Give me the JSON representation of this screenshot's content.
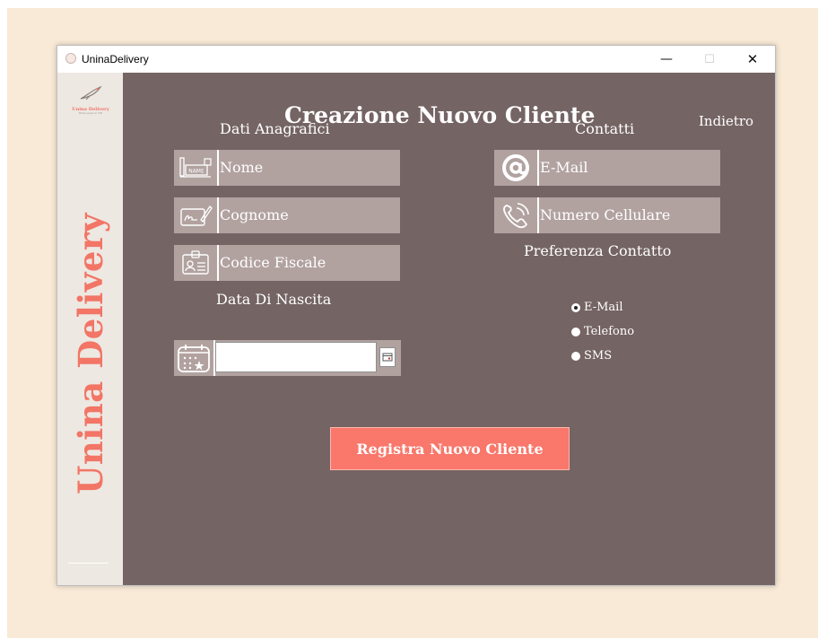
{
  "window": {
    "title": "UninaDelivery",
    "controls": {
      "minimize": "—",
      "maximize": "☐",
      "close": "✕"
    }
  },
  "sidebar": {
    "brand": "Unina Delivery",
    "logo_text": "Unina Delivery",
    "logo_subtext": "Where speed on TOP"
  },
  "header": {
    "title": "Creazione Nuovo Cliente",
    "back_label": "Indietro"
  },
  "personal": {
    "section_title": "Dati Anagrafici",
    "fields": [
      {
        "label": "Nome",
        "icon": "name-tag-icon"
      },
      {
        "label": "Cognome",
        "icon": "signature-icon"
      },
      {
        "label": "Codice Fiscale",
        "icon": "id-card-icon"
      }
    ],
    "birthdate": {
      "label": "Data Di Nascita",
      "value": "",
      "icon": "calendar-icon"
    }
  },
  "contacts": {
    "section_title": "Contatti",
    "fields": [
      {
        "label": "E-Mail",
        "icon": "at-icon"
      },
      {
        "label": "Numero Cellulare",
        "icon": "phone-icon"
      }
    ],
    "preference": {
      "title": "Preferenza Contatto",
      "options": [
        "E-Mail",
        "Telefono",
        "SMS"
      ],
      "selected": "E-Mail"
    }
  },
  "actions": {
    "register_label": "Registra Nuovo Cliente"
  },
  "colors": {
    "panel": "#756464",
    "field": "#b1a2a0",
    "accent": "#f9776b",
    "sidebar": "#ede8e2"
  }
}
